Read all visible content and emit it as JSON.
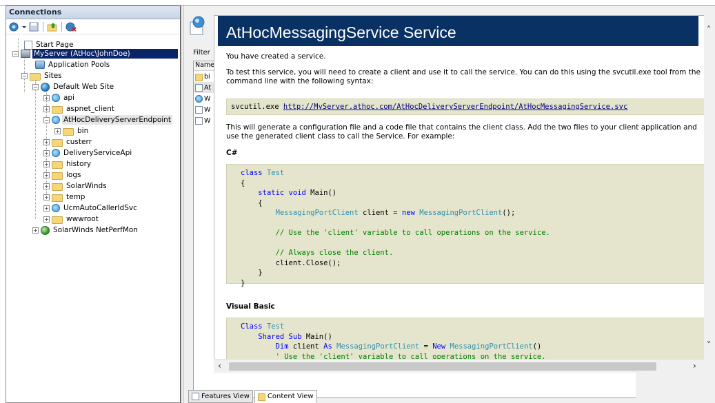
{
  "connections": {
    "header": "Connections",
    "toolbar": [
      "connect-icon",
      "save-icon",
      "up-icon",
      "delete-connection-icon"
    ],
    "tree": {
      "start_page": "Start Page",
      "server": "MyServer (AtHoc\\JohnDoe)",
      "app_pools": "Application Pools",
      "sites": "Sites",
      "default_site": "Default Web Site",
      "items": [
        "api",
        "aspnet_client",
        "AtHocDeliveryServerEndpoint",
        "bin",
        "custerr",
        "DeliveryServiceApi",
        "history",
        "logs",
        "SolarWinds",
        "temp",
        "UcmAutoCallerIdSvc",
        "wwwroot"
      ],
      "netperf": "SolarWinds NetPerfMon"
    }
  },
  "middle": {
    "filter_label": "Filter",
    "list_header": "Name",
    "rows": [
      "bi",
      "At",
      "W",
      "W",
      "W"
    ],
    "tabs": {
      "features": "Features View",
      "content": "Content View"
    }
  },
  "service_page": {
    "title": "AtHocMessagingService Service",
    "intro": "You have created a service.",
    "test_text": "To test this service, you will need to create a client and use it to call the service. You can do this using the svcutil.exe tool from the command line with the following syntax:",
    "svcutil_cmd": "svcutil.exe",
    "svcutil_url": "http://MyServer.athoc.com/AtHocDeliveryServerEndpoint/AtHocMessagingService.svc",
    "generate_text": "This will generate a configuration file and a code file that contains the client class. Add the two files to your client application and use the generated client class to call the Service. For example:",
    "csharp_heading": "C#",
    "csharp": {
      "l1_kw": "class",
      "l1_name": "Test",
      "l2": "{",
      "l3_kw": "static void",
      "l3_name": "Main()",
      "l4": "{",
      "l5_type": "MessagingPortClient",
      "l5_mid": "client =",
      "l5_kw": "new",
      "l5_type2": "MessagingPortClient",
      "l5_end": "();",
      "l6": "// Use the 'client' variable to call operations on the service.",
      "l7": "// Always close the client.",
      "l8": "client.Close();",
      "l9": "}",
      "l10": "}"
    },
    "vb_heading": "Visual Basic",
    "vb": {
      "l1_kw": "Class",
      "l1_name": "Test",
      "l2_kw": "Shared Sub",
      "l2_name": "Main()",
      "l3_kw": "Dim",
      "l3_mid": "client",
      "l3_as": "As",
      "l3_type": "MessagingPortClient",
      "l3_eq": "=",
      "l3_new": "New",
      "l3_type2": "MessagingPortClient",
      "l3_end": "()",
      "l4": "' Use the 'client' variable to call operations on the service."
    }
  },
  "colors": {
    "title_bar": "#0a3163",
    "code_bg": "#e4e5cc",
    "selection": "#0a246a"
  }
}
